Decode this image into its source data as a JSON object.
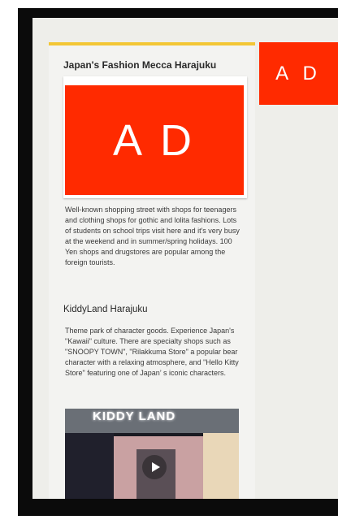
{
  "article": {
    "title": "Japan's Fashion Mecca Harajuku",
    "ad_label": "A D",
    "paragraph1": "Well-known shopping street with shops for teenagers and clothing shops for gothic and lolita fashions. Lots of students on school trips visit here and it's very busy at the weekend and in summer/spring holidays. 100 Yen shops and drugstores are popular among the foreign tourists.",
    "section2_title": "KiddyLand Harajuku",
    "paragraph2": "Theme park of character goods.  Experience Japan's \"Kawaii\" culture. There are specialty shops such as \"SNOOPY TOWN\", \"Rilakkuma Store\" a popular bear character with a relaxing atmosphere, and \"Hello Kitty Store\"  featuring one of Japan’ s iconic characters.",
    "video_sign_text": "KIDDY LAND"
  },
  "side_ad": {
    "label": "A D"
  },
  "colors": {
    "accent": "#f3c635",
    "ad": "#ff2a00"
  },
  "icons": {
    "play": "play-icon"
  }
}
